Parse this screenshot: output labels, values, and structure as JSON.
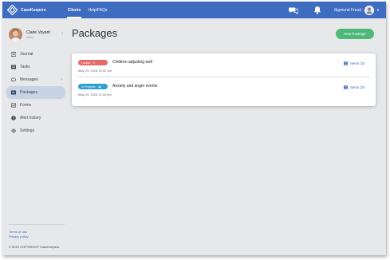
{
  "app": {
    "brand": "CaseKeepers",
    "nav": [
      {
        "label": "Clients",
        "active": true
      },
      {
        "label": "Help/FAQs",
        "active": false
      }
    ],
    "user_name": "Sigmund Freud"
  },
  "profile": {
    "name": "Claire Voyant",
    "role": "Client"
  },
  "sidebar": {
    "items": [
      {
        "label": "Journal",
        "icon": "journal-icon",
        "active": false
      },
      {
        "label": "Tasks",
        "icon": "tasks-icon",
        "active": false
      },
      {
        "label": "Messages",
        "icon": "messages-icon",
        "active": false,
        "expandable": true
      },
      {
        "label": "Packages",
        "icon": "packages-icon",
        "active": true
      },
      {
        "label": "Forms",
        "icon": "forms-icon",
        "active": false
      },
      {
        "label": "Alert history",
        "icon": "alert-icon",
        "active": false
      },
      {
        "label": "Settings",
        "icon": "settings-icon",
        "active": false
      }
    ],
    "footer_links": [
      "Terms of use",
      "Privacy policy"
    ],
    "copyright": "© 2019 COPYRIGHT CaseKeepers"
  },
  "main": {
    "title": "Packages",
    "new_button": "New Package",
    "packages": [
      {
        "status": "Locked",
        "status_color": "#e56a6a",
        "title": "Children adjusting well",
        "date": "May 23, 2018 10:22 pm",
        "items_label": "Items (3)"
      },
      {
        "status": "In Progress",
        "status_color": "#2f9fd1",
        "title": "Anxiety and anger events",
        "date": "May 23, 2018 11:18 pm",
        "items_label": "Items (3)"
      }
    ]
  },
  "colors": {
    "topbar": "#3d6cc0",
    "accent_green": "#4db877",
    "sidebar_active": "#c8d3e3",
    "background": "#e7e8ea"
  }
}
